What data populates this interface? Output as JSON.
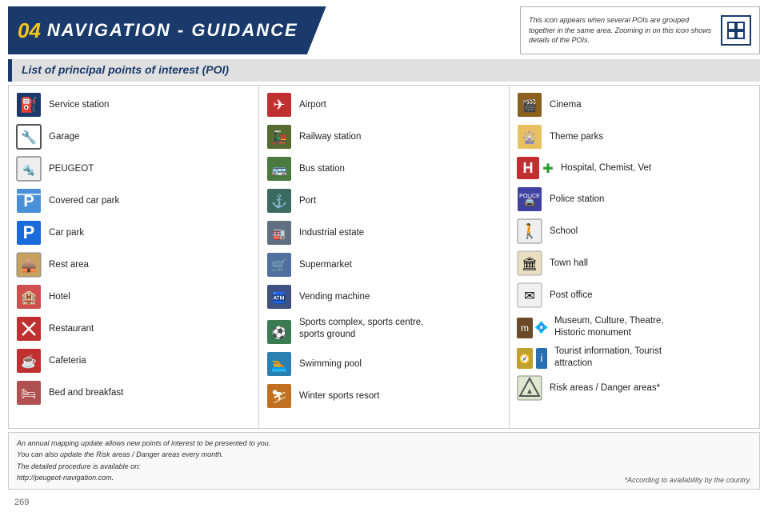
{
  "header": {
    "chapter_num": "04",
    "title": "NAVIGATION - GUIDANCE",
    "note": "This icon appears when several POIs are grouped together in the same area. Zooming in on this icon shows details of the POIs.",
    "icon": "grid-icon"
  },
  "subtitle": "List of principal points of interest (POI)",
  "columns": [
    {
      "id": "col1",
      "items": [
        {
          "id": "service-station",
          "label": "Service station",
          "icon_type": "service"
        },
        {
          "id": "garage",
          "label": "Garage",
          "icon_type": "garage"
        },
        {
          "id": "peugeot",
          "label": "PEUGEOT",
          "icon_type": "peugeot"
        },
        {
          "id": "covered-car-park",
          "label": "Covered car park",
          "icon_type": "covered-parking"
        },
        {
          "id": "car-park",
          "label": "Car park",
          "icon_type": "parking"
        },
        {
          "id": "rest-area",
          "label": "Rest area",
          "icon_type": "rest"
        },
        {
          "id": "hotel",
          "label": "Hotel",
          "icon_type": "hotel"
        },
        {
          "id": "restaurant",
          "label": "Restaurant",
          "icon_type": "restaurant"
        },
        {
          "id": "cafeteria",
          "label": "Cafeteria",
          "icon_type": "cafeteria"
        },
        {
          "id": "bed-breakfast",
          "label": "Bed and breakfast",
          "icon_type": "bed"
        }
      ]
    },
    {
      "id": "col2",
      "items": [
        {
          "id": "airport",
          "label": "Airport",
          "icon_type": "airport"
        },
        {
          "id": "railway-station",
          "label": "Railway station",
          "icon_type": "railway"
        },
        {
          "id": "bus-station",
          "label": "Bus station",
          "icon_type": "bus"
        },
        {
          "id": "port",
          "label": "Port",
          "icon_type": "port"
        },
        {
          "id": "industrial-estate",
          "label": "Industrial estate",
          "icon_type": "industrial"
        },
        {
          "id": "supermarket",
          "label": "Supermarket",
          "icon_type": "supermarket"
        },
        {
          "id": "vending-machine",
          "label": "Vending machine",
          "icon_type": "vending"
        },
        {
          "id": "sports-complex",
          "label": "Sports complex, sports centre,\nsports ground",
          "icon_type": "sports"
        },
        {
          "id": "swimming-pool",
          "label": "Swimming pool",
          "icon_type": "swimming"
        },
        {
          "id": "winter-sports",
          "label": "Winter sports resort",
          "icon_type": "winter"
        }
      ]
    },
    {
      "id": "col3",
      "items": [
        {
          "id": "cinema",
          "label": "Cinema",
          "icon_type": "cinema"
        },
        {
          "id": "theme-parks",
          "label": "Theme parks",
          "icon_type": "theme-parks"
        },
        {
          "id": "hospital",
          "label": "Hospital, Chemist, Vet",
          "icon_type": "hospital"
        },
        {
          "id": "police-station",
          "label": "Police station",
          "icon_type": "police"
        },
        {
          "id": "school",
          "label": "School",
          "icon_type": "school"
        },
        {
          "id": "town-hall",
          "label": "Town hall",
          "icon_type": "town-hall"
        },
        {
          "id": "post-office",
          "label": "Post office",
          "icon_type": "post"
        },
        {
          "id": "museum",
          "label": "Museum, Culture, Theatre,\nHistoric monument",
          "icon_type": "museum"
        },
        {
          "id": "tourist-info",
          "label": "Tourist information, Tourist\nattraction",
          "icon_type": "tourist"
        },
        {
          "id": "risk-areas",
          "label": "Risk areas / Danger areas*",
          "icon_type": "risk"
        }
      ]
    }
  ],
  "footer": {
    "note_lines": [
      "An annual mapping update allows new points of interest to be presented to you.",
      "You can also update the Risk areas / Danger areas every month.",
      "The detailed procedure is available on:",
      "http://peugeot-navigation.com."
    ],
    "asterisk_note": "*According to availability by the country."
  },
  "page_number": "269"
}
